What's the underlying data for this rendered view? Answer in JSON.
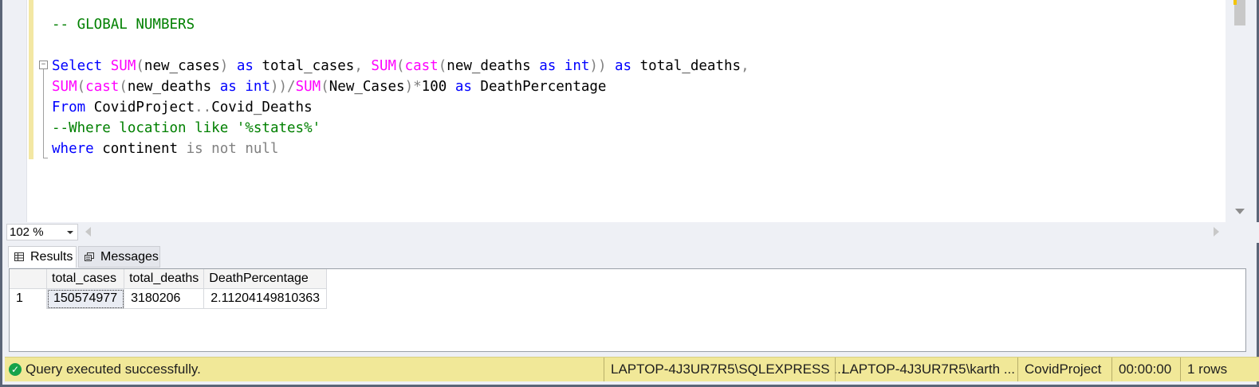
{
  "editor": {
    "lines": [
      {
        "tokens": [
          {
            "t": "-- GLOBAL NUMBERS",
            "c": "cm"
          }
        ]
      },
      {
        "tokens": [
          {
            "t": "Select ",
            "c": "kw"
          },
          {
            "t": "SUM",
            "c": "fn"
          },
          {
            "t": "(",
            "c": "gr"
          },
          {
            "t": "new_cases",
            "c": ""
          },
          {
            "t": ") ",
            "c": "gr"
          },
          {
            "t": "as ",
            "c": "kw"
          },
          {
            "t": "total_cases",
            "c": ""
          },
          {
            "t": ", ",
            "c": "gr"
          },
          {
            "t": "SUM",
            "c": "fn"
          },
          {
            "t": "(",
            "c": "gr"
          },
          {
            "t": "cast",
            "c": "fn"
          },
          {
            "t": "(",
            "c": "gr"
          },
          {
            "t": "new_deaths ",
            "c": ""
          },
          {
            "t": "as ",
            "c": "kw"
          },
          {
            "t": "int",
            "c": "kw"
          },
          {
            "t": ")) ",
            "c": "gr"
          },
          {
            "t": "as ",
            "c": "kw"
          },
          {
            "t": "total_deaths",
            "c": ""
          },
          {
            "t": ",",
            "c": "gr"
          }
        ]
      },
      {
        "tokens": [
          {
            "t": "SUM",
            "c": "fn"
          },
          {
            "t": "(",
            "c": "gr"
          },
          {
            "t": "cast",
            "c": "fn"
          },
          {
            "t": "(",
            "c": "gr"
          },
          {
            "t": "new_deaths ",
            "c": ""
          },
          {
            "t": "as ",
            "c": "kw"
          },
          {
            "t": "int",
            "c": "kw"
          },
          {
            "t": "))/",
            "c": "gr"
          },
          {
            "t": "SUM",
            "c": "fn"
          },
          {
            "t": "(",
            "c": "gr"
          },
          {
            "t": "New_Cases",
            "c": ""
          },
          {
            "t": ")*",
            "c": "gr"
          },
          {
            "t": "100 ",
            "c": ""
          },
          {
            "t": "as ",
            "c": "kw"
          },
          {
            "t": "DeathPercentage",
            "c": ""
          }
        ]
      },
      {
        "tokens": [
          {
            "t": "From ",
            "c": "kw"
          },
          {
            "t": "CovidProject",
            "c": ""
          },
          {
            "t": "..",
            "c": "gr"
          },
          {
            "t": "Covid_Deaths",
            "c": ""
          }
        ]
      },
      {
        "tokens": [
          {
            "t": "--Where location like ",
            "c": "cm"
          },
          {
            "t": "'%states%'",
            "c": "cm"
          }
        ]
      },
      {
        "tokens": [
          {
            "t": "where ",
            "c": "kw"
          },
          {
            "t": "continent ",
            "c": ""
          },
          {
            "t": "is not null",
            "c": "gr"
          }
        ]
      }
    ]
  },
  "zoom": {
    "value": "102 %"
  },
  "tabs": [
    {
      "label": "Results",
      "icon": "grid-icon",
      "active": true
    },
    {
      "label": "Messages",
      "icon": "messages-icon",
      "active": false
    }
  ],
  "results": {
    "columns": [
      "total_cases",
      "total_deaths",
      "DeathPercentage"
    ],
    "rows": [
      {
        "num": "1",
        "cells": [
          "150574977",
          "3180206",
          "2.11204149810363"
        ]
      }
    ]
  },
  "status": {
    "message": "Query executed successfully.",
    "server": "LAPTOP-4J3UR7R5\\SQLEXPRESS ...",
    "user": "LAPTOP-4J3UR7R5\\karth ...",
    "database": "CovidProject",
    "elapsed": "00:00:00",
    "rows": "1 rows"
  },
  "colors": {
    "keyword": "#0000ff",
    "function": "#ff00ff",
    "comment": "#008000",
    "operator": "#808080",
    "status_bar": "#f1e898",
    "success": "#16a34a"
  }
}
